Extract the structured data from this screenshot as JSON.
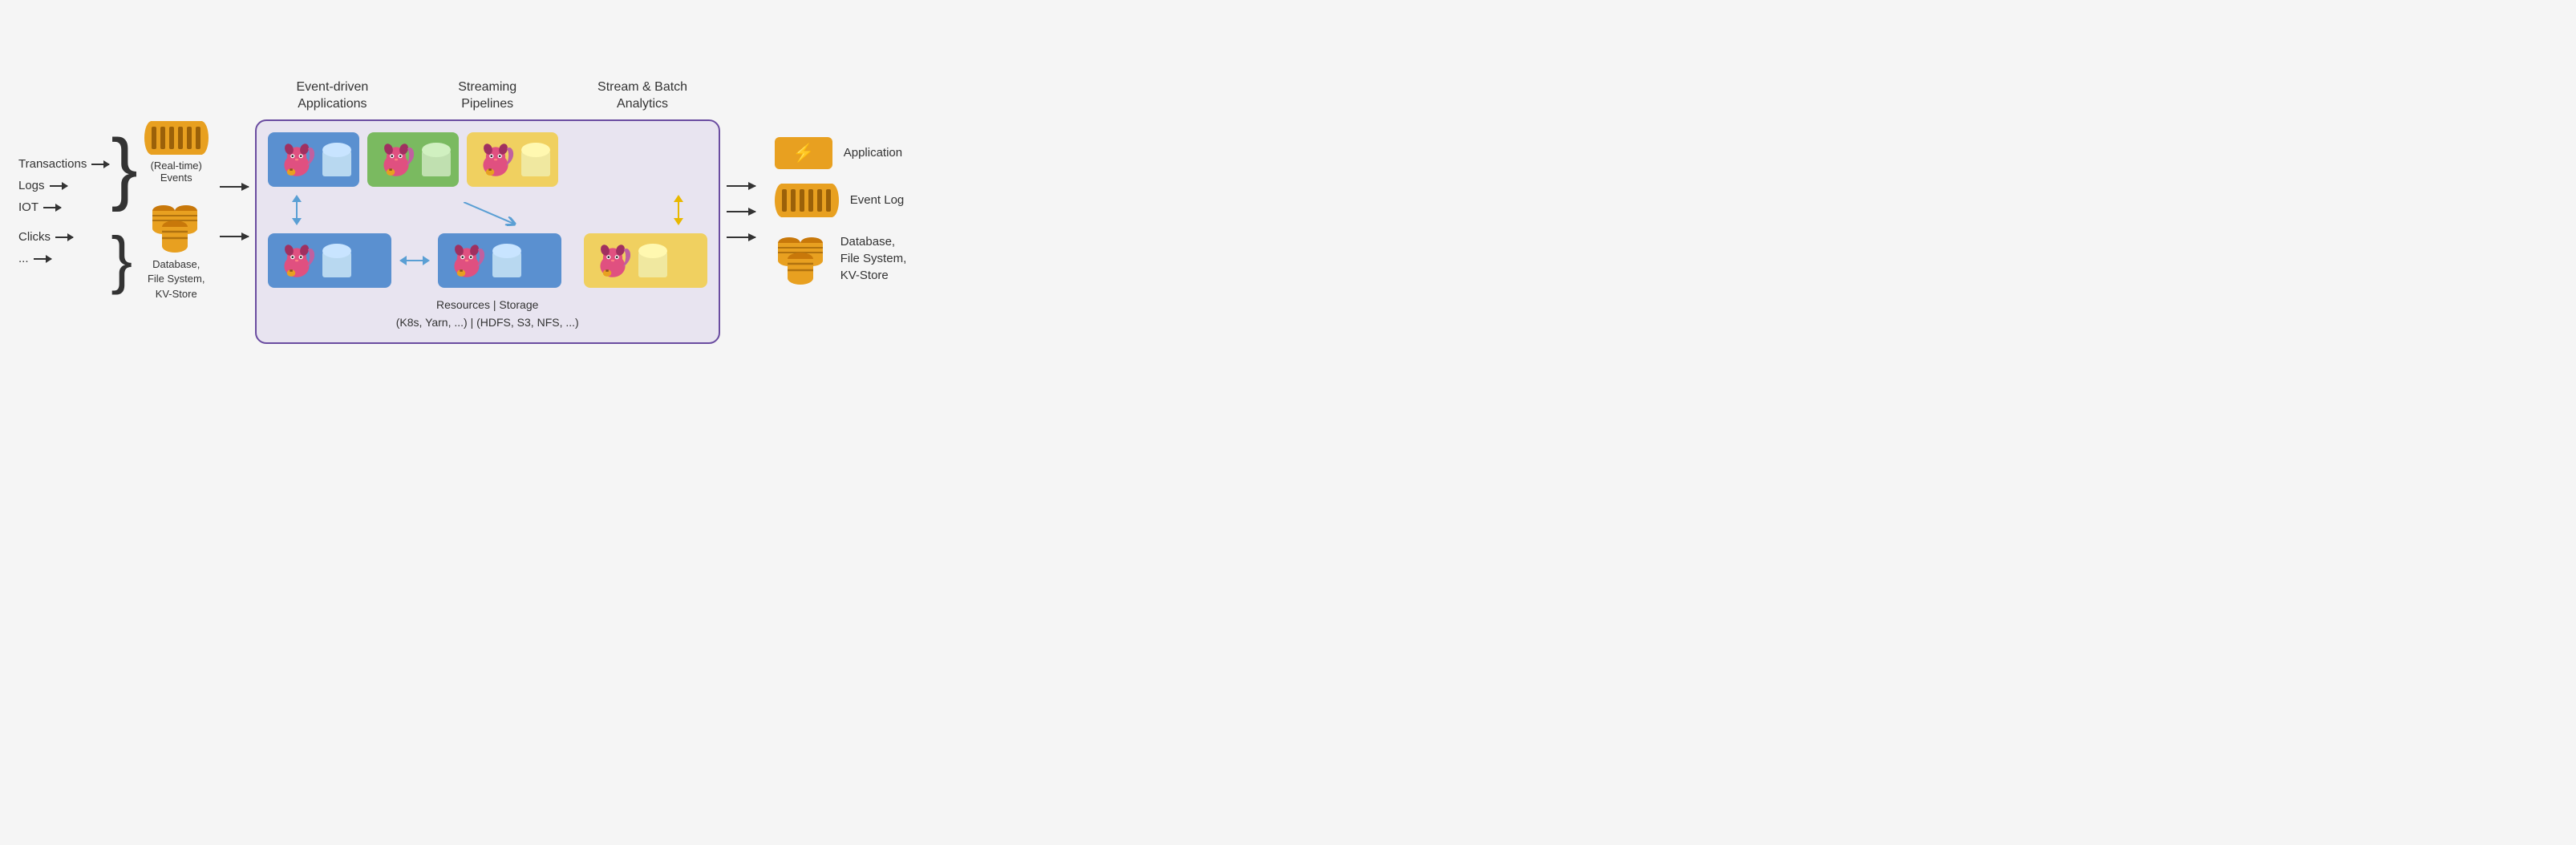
{
  "headers": {
    "col1": "Event-driven\nApplications",
    "col2": "Streaming\nPipelines",
    "col3": "Stream & Batch\nAnalytics"
  },
  "inputs": {
    "items": [
      "Transactions",
      "Logs",
      "IOT",
      "Clicks",
      "..."
    ],
    "events_label": "(Real-time)\nEvents",
    "db_label": "Database,\nFile System,\nKV-Store"
  },
  "mainbox": {
    "bottom_label": "Resources | Storage\n(K8s, Yarn, ...) | (HDFS, S3, NFS, ...)"
  },
  "outputs": {
    "app_label": "Application",
    "eventlog_label": "Event Log",
    "db_label": "Database,\nFile System,\nKV-Store"
  }
}
